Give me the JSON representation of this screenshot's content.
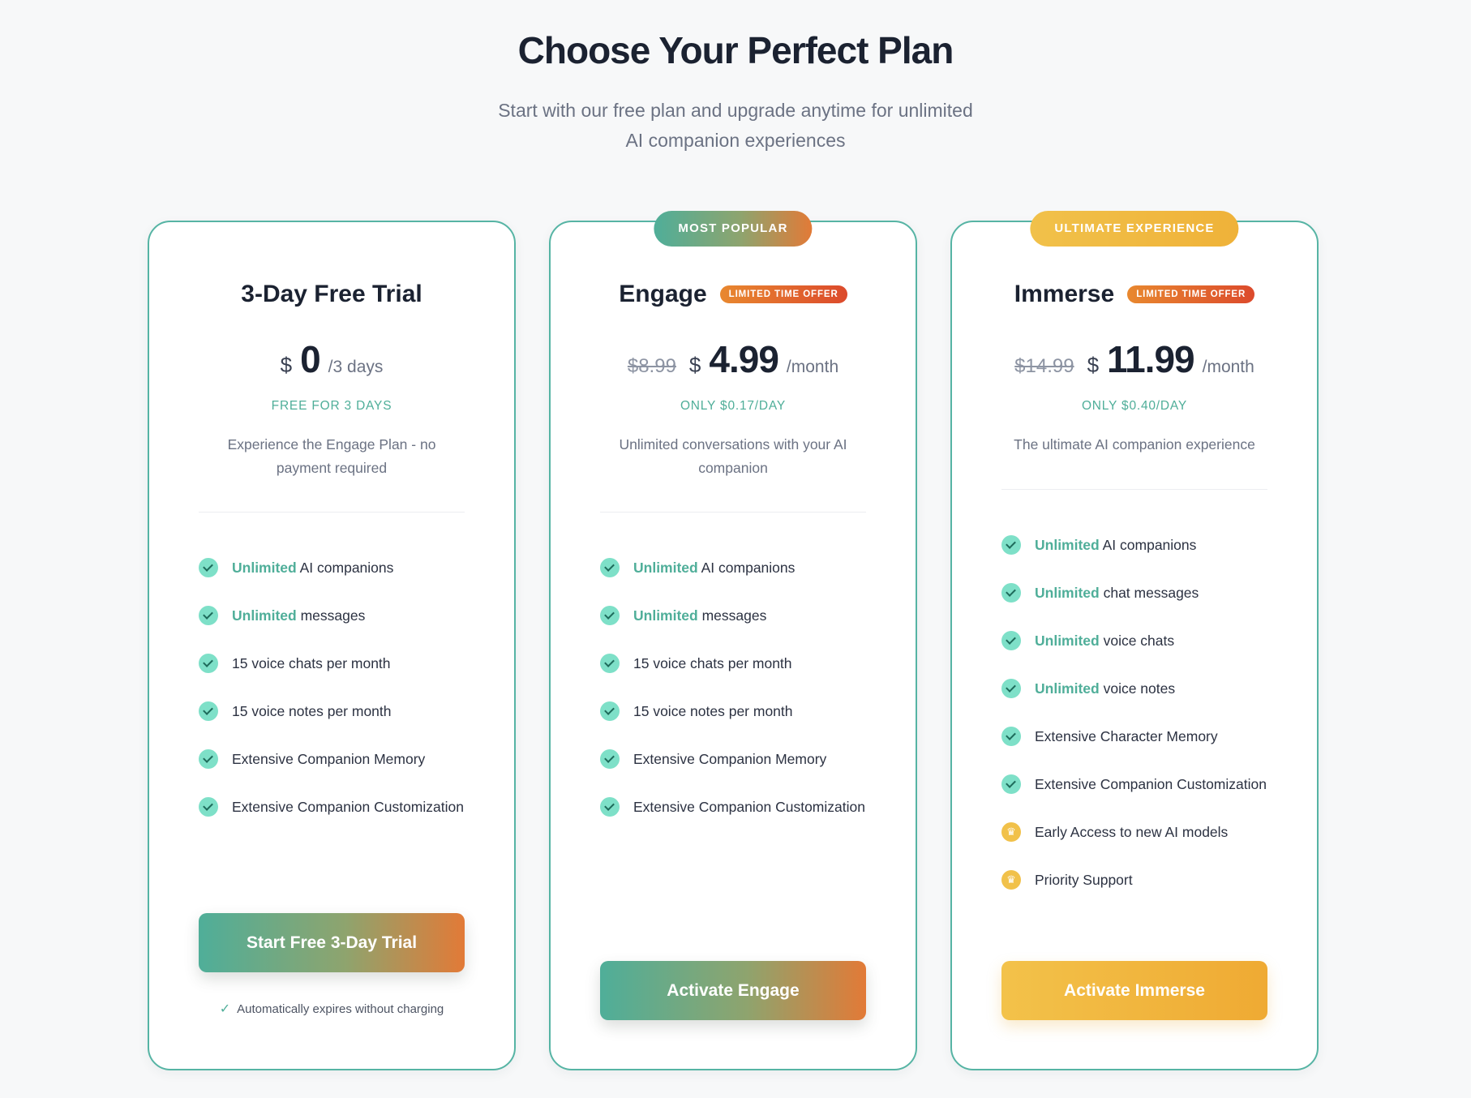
{
  "header": {
    "title": "Choose Your Perfect Plan",
    "subtitle_line1": "Start with our free plan and upgrade anytime for unlimited",
    "subtitle_line2": "AI companion experiences"
  },
  "plans": [
    {
      "name": "3-Day Free Trial",
      "currency": "$",
      "price": "0",
      "period": "/3 days",
      "per_day": "FREE FOR 3 DAYS",
      "desc_line1": "Experience the Engage Plan - no",
      "desc_line2": "payment required",
      "features": [
        {
          "highlight": "Unlimited",
          "text": " AI companions",
          "icon": "check-icon"
        },
        {
          "highlight": "Unlimited",
          "text": " messages",
          "icon": "check-icon"
        },
        {
          "highlight": "",
          "text": "15 voice chats per month",
          "icon": "check-icon"
        },
        {
          "highlight": "",
          "text": "15 voice notes per month",
          "icon": "check-icon"
        },
        {
          "highlight": "",
          "text": "Extensive Companion Memory",
          "icon": "check-icon"
        },
        {
          "highlight": "",
          "text": "Extensive Companion Customization",
          "icon": "check-icon"
        }
      ],
      "cta": "Start Free 3-Day Trial",
      "note": "Automatically expires without charging"
    },
    {
      "top_badge": "MOST POPULAR",
      "name": "Engage",
      "offer_badge": "LIMITED TIME OFFER",
      "old_price": "$8.99",
      "currency": "$",
      "price": "4.99",
      "period": "/month",
      "per_day": "ONLY $0.17/DAY",
      "desc_line1": "Unlimited conversations with your AI",
      "desc_line2": "companion",
      "features": [
        {
          "highlight": "Unlimited",
          "text": " AI companions",
          "icon": "check-icon"
        },
        {
          "highlight": "Unlimited",
          "text": " messages",
          "icon": "check-icon"
        },
        {
          "highlight": "",
          "text": "15 voice chats per month",
          "icon": "check-icon"
        },
        {
          "highlight": "",
          "text": "15 voice notes per month",
          "icon": "check-icon"
        },
        {
          "highlight": "",
          "text": "Extensive Companion Memory",
          "icon": "check-icon"
        },
        {
          "highlight": "",
          "text": "Extensive Companion Customization",
          "icon": "check-icon"
        }
      ],
      "cta": "Activate Engage"
    },
    {
      "top_badge": "ULTIMATE EXPERIENCE",
      "name": "Immerse",
      "offer_badge": "LIMITED TIME OFFER",
      "old_price": "$14.99",
      "currency": "$",
      "price": "11.99",
      "period": "/month",
      "per_day": "ONLY $0.40/DAY",
      "desc_line1": "The ultimate AI companion experience",
      "features": [
        {
          "highlight": "Unlimited",
          "text": " AI companions",
          "icon": "check-icon"
        },
        {
          "highlight": "Unlimited",
          "text": " chat messages",
          "icon": "check-icon"
        },
        {
          "highlight": "Unlimited",
          "text": " voice chats",
          "icon": "check-icon"
        },
        {
          "highlight": "Unlimited",
          "text": " voice notes",
          "icon": "check-icon"
        },
        {
          "highlight": "",
          "text": "Extensive Character Memory",
          "icon": "check-icon"
        },
        {
          "highlight": "",
          "text": "Extensive Companion Customization",
          "icon": "check-icon"
        },
        {
          "highlight": "",
          "text": "Early Access to new AI models",
          "icon": "crown-icon"
        },
        {
          "highlight": "",
          "text": "Priority Support",
          "icon": "crown-icon"
        }
      ],
      "cta": "Activate Immerse"
    }
  ],
  "colors": {
    "accent": "#4fae99",
    "card_border": "#56b4a4",
    "gold": "#f1c14a",
    "offer": "#e27a37",
    "check": "#7ee0c8"
  }
}
